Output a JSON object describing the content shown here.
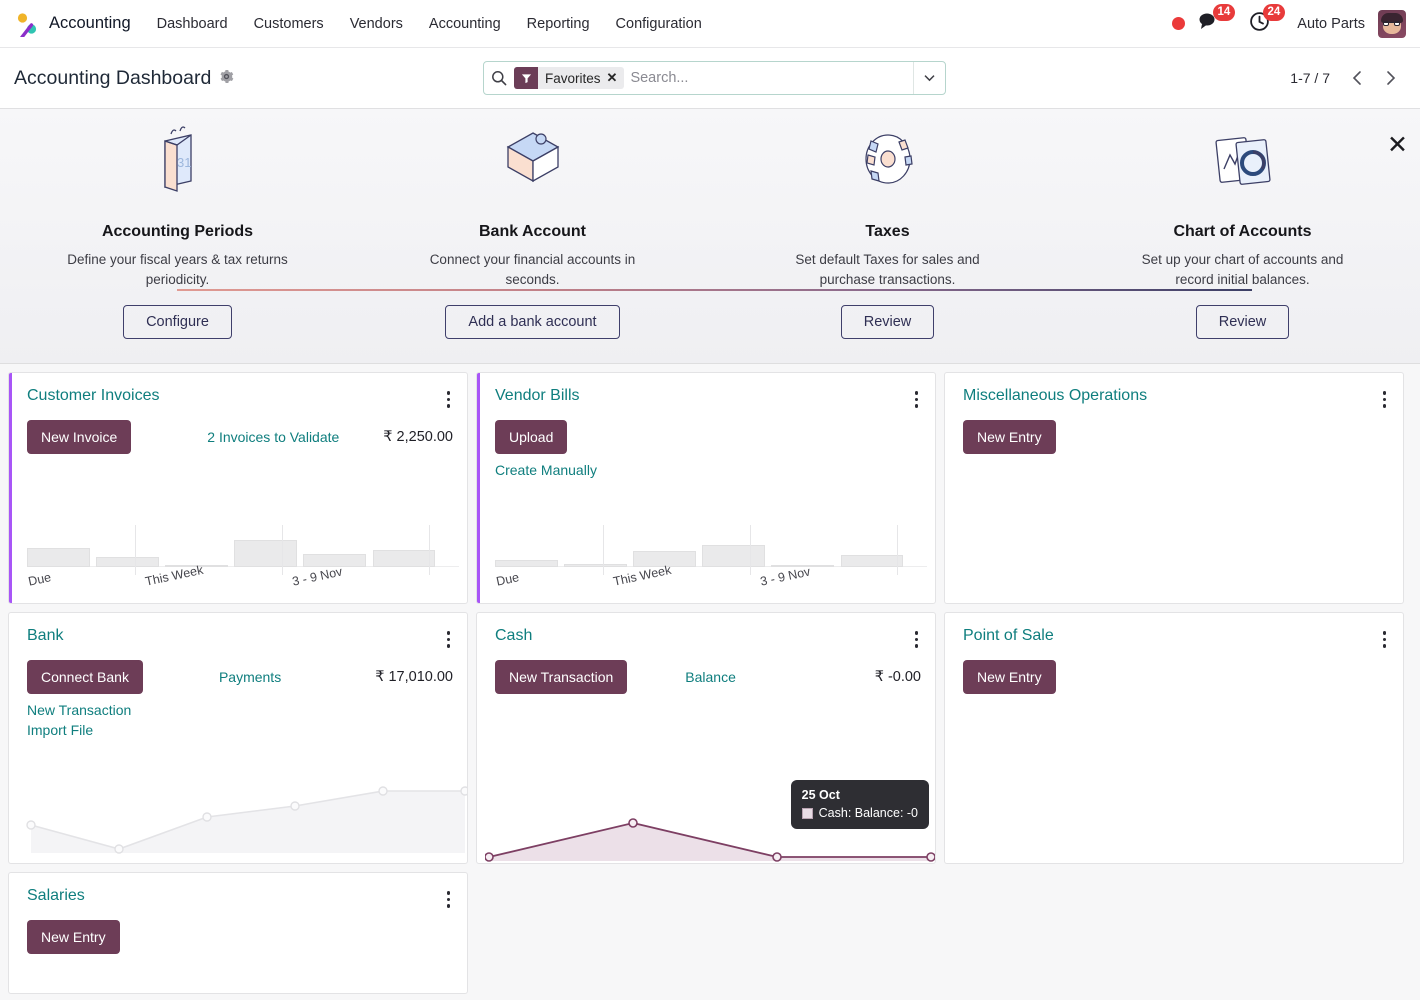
{
  "navbar": {
    "brand": "Accounting",
    "brand_logo_icon": "odoo-accounting-logo-icon",
    "menu": [
      "Dashboard",
      "Customers",
      "Vendors",
      "Accounting",
      "Reporting",
      "Configuration"
    ],
    "status_dot_icon": "recording-dot-icon",
    "messages_icon": "chat-bubble-icon",
    "messages_count": "14",
    "activities_icon": "clock-icon",
    "activities_count": "24",
    "user_name": "Auto Parts",
    "avatar_icon": "user-avatar-icon"
  },
  "control_panel": {
    "title": "Accounting Dashboard",
    "gear_icon": "gear-icon",
    "search": {
      "search_icon": "search-icon",
      "facet_icon": "filter-funnel-icon",
      "facet_label": "Favorites",
      "facet_remove_icon": "close-x-icon",
      "placeholder": "Search...",
      "dropdown_icon": "chevron-down-icon"
    },
    "pager": {
      "range": "1-7 / 7",
      "prev_icon": "chevron-left-icon",
      "next_icon": "chevron-right-icon"
    }
  },
  "onboarding": {
    "close_icon": "close-x-icon",
    "steps": [
      {
        "art_icon": "calendar-31-icon",
        "title": "Accounting Periods",
        "desc": "Define your fiscal years & tax returns periodicity.",
        "button": "Configure"
      },
      {
        "art_icon": "puzzle-bank-icon",
        "title": "Bank Account",
        "desc": "Connect your financial accounts in seconds.",
        "button": "Add a bank account"
      },
      {
        "art_icon": "gear-taxes-icon",
        "title": "Taxes",
        "desc": "Set default Taxes for sales and purchase transactions.",
        "button": "Review"
      },
      {
        "art_icon": "chart-of-accounts-icon",
        "title": "Chart of Accounts",
        "desc": "Set up your chart of accounts and record initial balances.",
        "button": "Review"
      }
    ]
  },
  "cards": {
    "customer_invoices": {
      "title": "Customer Invoices",
      "primary_button": "New Invoice",
      "stat_label": "2 Invoices to Validate",
      "amount": "₹ 2,250.00",
      "menu_icon": "kebab-menu-icon"
    },
    "vendor_bills": {
      "title": "Vendor Bills",
      "primary_button": "Upload",
      "secondary_link": "Create Manually",
      "menu_icon": "kebab-menu-icon"
    },
    "misc_operations": {
      "title": "Miscellaneous Operations",
      "primary_button": "New Entry",
      "menu_icon": "kebab-menu-icon"
    },
    "bank": {
      "title": "Bank",
      "primary_button": "Connect Bank",
      "stat_label": "Payments",
      "amount": "₹ 17,010.00",
      "link_new_transaction": "New Transaction",
      "link_import_file": "Import File",
      "menu_icon": "kebab-menu-icon"
    },
    "cash": {
      "title": "Cash",
      "primary_button": "New Transaction",
      "stat_label": "Balance",
      "amount": "₹ -0.00",
      "menu_icon": "kebab-menu-icon",
      "tooltip": {
        "date": "25 Oct",
        "series": "Cash: Balance: -0"
      }
    },
    "point_of_sale": {
      "title": "Point of Sale",
      "primary_button": "New Entry",
      "menu_icon": "kebab-menu-icon"
    },
    "salaries": {
      "title": "Salaries",
      "primary_button": "New Entry",
      "menu_icon": "kebab-menu-icon"
    }
  },
  "chart_data": [
    {
      "id": "customer_invoices_bars",
      "type": "bar",
      "title": "Customer Invoices",
      "categories": [
        "Due",
        "",
        "This Week",
        "",
        "3 - 9 Nov",
        ""
      ],
      "tick_labels": [
        "Due",
        "This Week",
        "3 - 9 Nov"
      ],
      "values": [
        19,
        10,
        1,
        27,
        13,
        17
      ],
      "ylim": [
        0,
        30
      ],
      "grid": false,
      "legend": "none",
      "bar_color": "#eaeaeb"
    },
    {
      "id": "vendor_bills_bars",
      "type": "bar",
      "title": "Vendor Bills",
      "categories": [
        "Due",
        "",
        "This Week",
        "",
        "3 - 9 Nov",
        ""
      ],
      "tick_labels": [
        "Due",
        "This Week",
        "3 - 9 Nov"
      ],
      "values": [
        6,
        3,
        16,
        22,
        0,
        12
      ],
      "ylim": [
        0,
        30
      ],
      "grid": false,
      "legend": "none",
      "bar_color": "#eaeaeb"
    },
    {
      "id": "bank_line",
      "type": "line",
      "title": "Bank",
      "x": [
        0,
        1,
        2,
        3,
        4,
        5
      ],
      "values": [
        28,
        6,
        38,
        52,
        70,
        70
      ],
      "ylim": [
        0,
        80
      ],
      "grid": false,
      "legend": "none",
      "line_color": "#e3e3e6",
      "area_color": "#f4f4f6"
    },
    {
      "id": "cash_line",
      "type": "line",
      "title": "Cash",
      "x": [
        0,
        1,
        2,
        3
      ],
      "values": [
        0,
        52,
        0,
        0
      ],
      "ylim": [
        0,
        60
      ],
      "grid": false,
      "legend": "none",
      "line_color": "#7d3f63",
      "area_color": "#ece0e8"
    }
  ]
}
